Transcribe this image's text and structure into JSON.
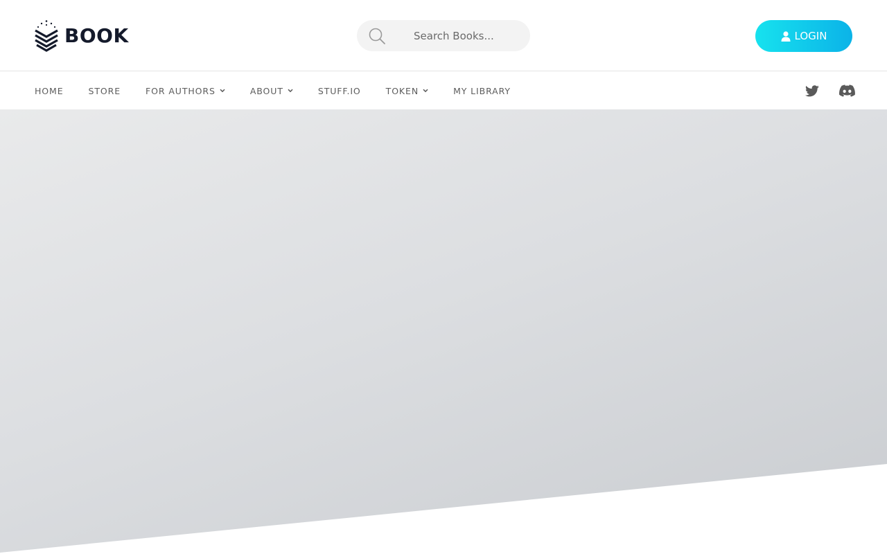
{
  "brand": {
    "name": "BOOK",
    "logo_icon": "chevron-stack-logo"
  },
  "search": {
    "placeholder": "Search Books...",
    "value": "",
    "icon": "search-icon"
  },
  "login": {
    "label": "LOGIN",
    "icon": "user-icon"
  },
  "nav": {
    "items": [
      {
        "label": "HOME",
        "dropdown": false
      },
      {
        "label": "STORE",
        "dropdown": false
      },
      {
        "label": "FOR AUTHORS",
        "dropdown": true
      },
      {
        "label": "ABOUT",
        "dropdown": true
      },
      {
        "label": "STUFF.IO",
        "dropdown": false
      },
      {
        "label": "TOKEN",
        "dropdown": true
      },
      {
        "label": "MY LIBRARY",
        "dropdown": false
      }
    ]
  },
  "social": [
    {
      "name": "Twitter",
      "icon": "twitter-icon"
    },
    {
      "name": "Discord",
      "icon": "discord-icon"
    }
  ],
  "colors": {
    "brand_text": "#141a2b",
    "login_gradient_start": "#17e2ee",
    "login_gradient_end": "#0bb3e8",
    "nav_text": "#5c5c5c",
    "social_icon": "#5a5a5a",
    "hero_light": "#e9eaeb",
    "hero_dark": "#c9ccd0"
  }
}
